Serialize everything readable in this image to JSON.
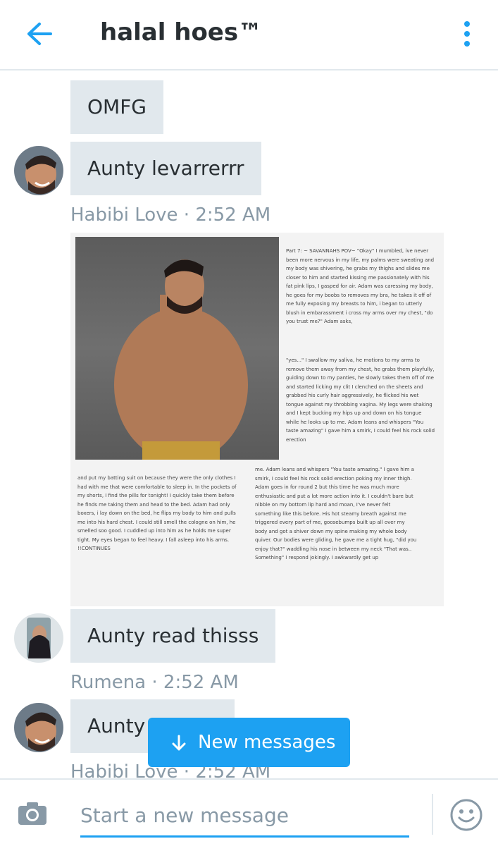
{
  "header": {
    "title": "halal hoes™",
    "back_icon": "arrow-left-icon",
    "menu_icon": "more-vertical-icon"
  },
  "messages": [
    {
      "text": "OMFG"
    },
    {
      "text": "Aunty levarrerrr",
      "author": "Habibi Love",
      "time": "2:52 AM",
      "meta": "Habibi Love · 2:52 AM"
    },
    {
      "type": "image",
      "paragraphs": {
        "p1": "Part 7: ~ SAVANNAHS POV~ \"Okay\" I mumbled, ive never been more nervous in my life, my palms were sweating and my body was shivering, he grabs my thighs and slides me closer to him and started kissing me passionately with his fat pink lips, I gasped for air. Adam was caressing my body, he goes for my boobs to removes my bra, he takes it off of me fully exposing my breasts to him, i began to utterly blush in embarassment i cross my arms over my chest, \"do you trust me?\" Adam asks,",
        "p2": "\"yes...\" I swallow my saliva, he motions to my arms to remove them away from my chest, he grabs them playfully, guiding down to my panties, he slowly takes them off of me and started licking my clit I clenched on the sheets and grabbed his curly hair aggressively, he flicked his wet tongue against my throbbing vagina. My legs were shaking and I kept bucking my hips up and down on his tongue while he looks up to me. Adam leans and whispers \"You taste amazing\" I gave him a smirk, I could feel his rock solid erection",
        "p3": "and put my batting suit on because they were the only clothes I had with me that were comfortable to sleep in. In the pockets of my shorts, I find the pills for tonight! I quickly take them before he finds me taking them and head to the bed. Adam had only boxers, i lay down on the bed, he flips my body to him and pulls me into his hard chest. I could still smell the cologne on him, he smelled soo good. I cuddled up into him as he holds me super tight. My eyes began to feel heavy. I fall asleep into his arms. !!CONTINUES",
        "p4": "me. Adam leans and whispers \"You taste amazing.\" I gave him a smirk, I could feel his rock solid erection poking my inner thigh. Adam goes in for round 2 but this time he was much more enthusiastic and put a lot more action into it. I couldn't bare but nibble on my bottom lip hard and moan, I've never felt something like this before. His hot steamy breath against me triggered every part of me, goosebumps built up all over my body and got a shiver down my spine making my whole body quiver. Our bodies were gliding, he gave me a tight hug, \"did you enjoy that?\" waddling his nose in between my neck \"That was.. Something\" I respond jokingly. I awkwardly get up"
      }
    },
    {
      "text": "Aunty read thisss",
      "author": "Rumena",
      "time": "2:52 AM",
      "meta": "Rumena · 2:52 AM"
    },
    {
      "text": "Aunty",
      "author": "Habibi Love",
      "time": "2:52 AM",
      "meta": "Habibi Love · 2:52 AM"
    }
  ],
  "new_messages": {
    "label": "New messages",
    "icon": "arrow-down-icon"
  },
  "composer": {
    "placeholder": "Start a new message",
    "camera_icon": "camera-icon",
    "emoji_icon": "smiley-icon"
  },
  "colors": {
    "accent": "#1da1f2",
    "bubble": "#e1e8ed",
    "meta_text": "#8899a6",
    "text": "#292f33"
  }
}
